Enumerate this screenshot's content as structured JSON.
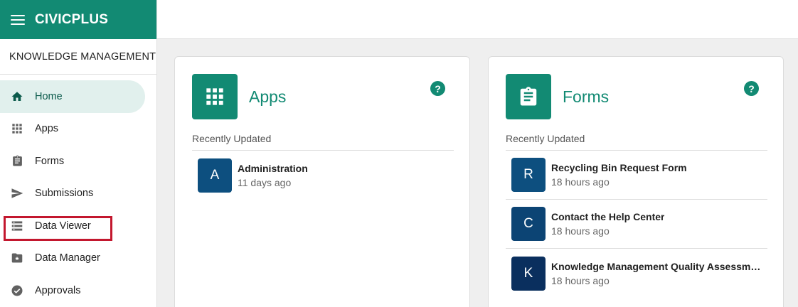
{
  "brand": {
    "name": "CIVICPLUS"
  },
  "sidebar": {
    "section_label": "KNOWLEDGE MANAGEMENT",
    "items": [
      {
        "label": "Home",
        "icon": "home-icon",
        "active": true
      },
      {
        "label": "Apps",
        "icon": "apps-grid-icon"
      },
      {
        "label": "Forms",
        "icon": "clipboard-icon"
      },
      {
        "label": "Submissions",
        "icon": "send-icon"
      },
      {
        "label": "Data Viewer",
        "icon": "table-rows-icon",
        "highlighted": true
      },
      {
        "label": "Data Manager",
        "icon": "folder-star-icon"
      },
      {
        "label": "Approvals",
        "icon": "check-circle-icon"
      }
    ]
  },
  "cards": {
    "apps": {
      "title": "Apps",
      "help": "?",
      "section_label": "Recently Updated",
      "items": [
        {
          "initial": "A",
          "title": "Administration",
          "time": "11 days ago",
          "color": "#0d4f7f"
        }
      ]
    },
    "forms": {
      "title": "Forms",
      "help": "?",
      "section_label": "Recently Updated",
      "items": [
        {
          "initial": "R",
          "title": "Recycling Bin Request Form",
          "time": "18 hours ago",
          "color": "#0d4f7f"
        },
        {
          "initial": "C",
          "title": "Contact the Help Center",
          "time": "18 hours ago",
          "color": "#0c4474"
        },
        {
          "initial": "K",
          "title": "Knowledge Management Quality Assessment Form",
          "time": "18 hours ago",
          "color": "#0a2f5e"
        }
      ]
    }
  },
  "colors": {
    "brand": "#128a73",
    "active_nav_bg": "#e1f0ed",
    "highlight": "#c3172e"
  }
}
